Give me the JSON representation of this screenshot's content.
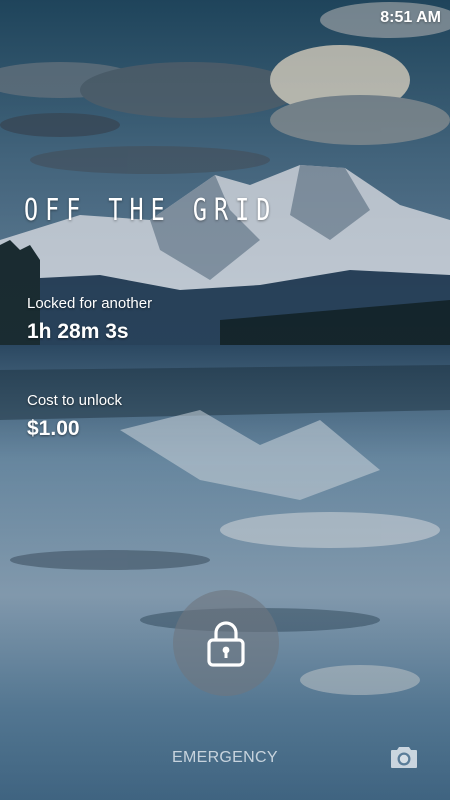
{
  "status_bar": {
    "time": "8:51 AM"
  },
  "app": {
    "title": "OFF THE GRID"
  },
  "lock_timer": {
    "label": "Locked for another",
    "value": "1h 28m 3s"
  },
  "unlock_cost": {
    "label": "Cost to unlock",
    "value": "$1.00"
  },
  "actions": {
    "lock_icon": "padlock-icon",
    "emergency_label": "EMERGENCY",
    "camera_icon": "camera-icon"
  },
  "colors": {
    "sky_top": "#2c5670",
    "lake": "#5d83a0",
    "mountain_snow": "#d9e1ea"
  }
}
